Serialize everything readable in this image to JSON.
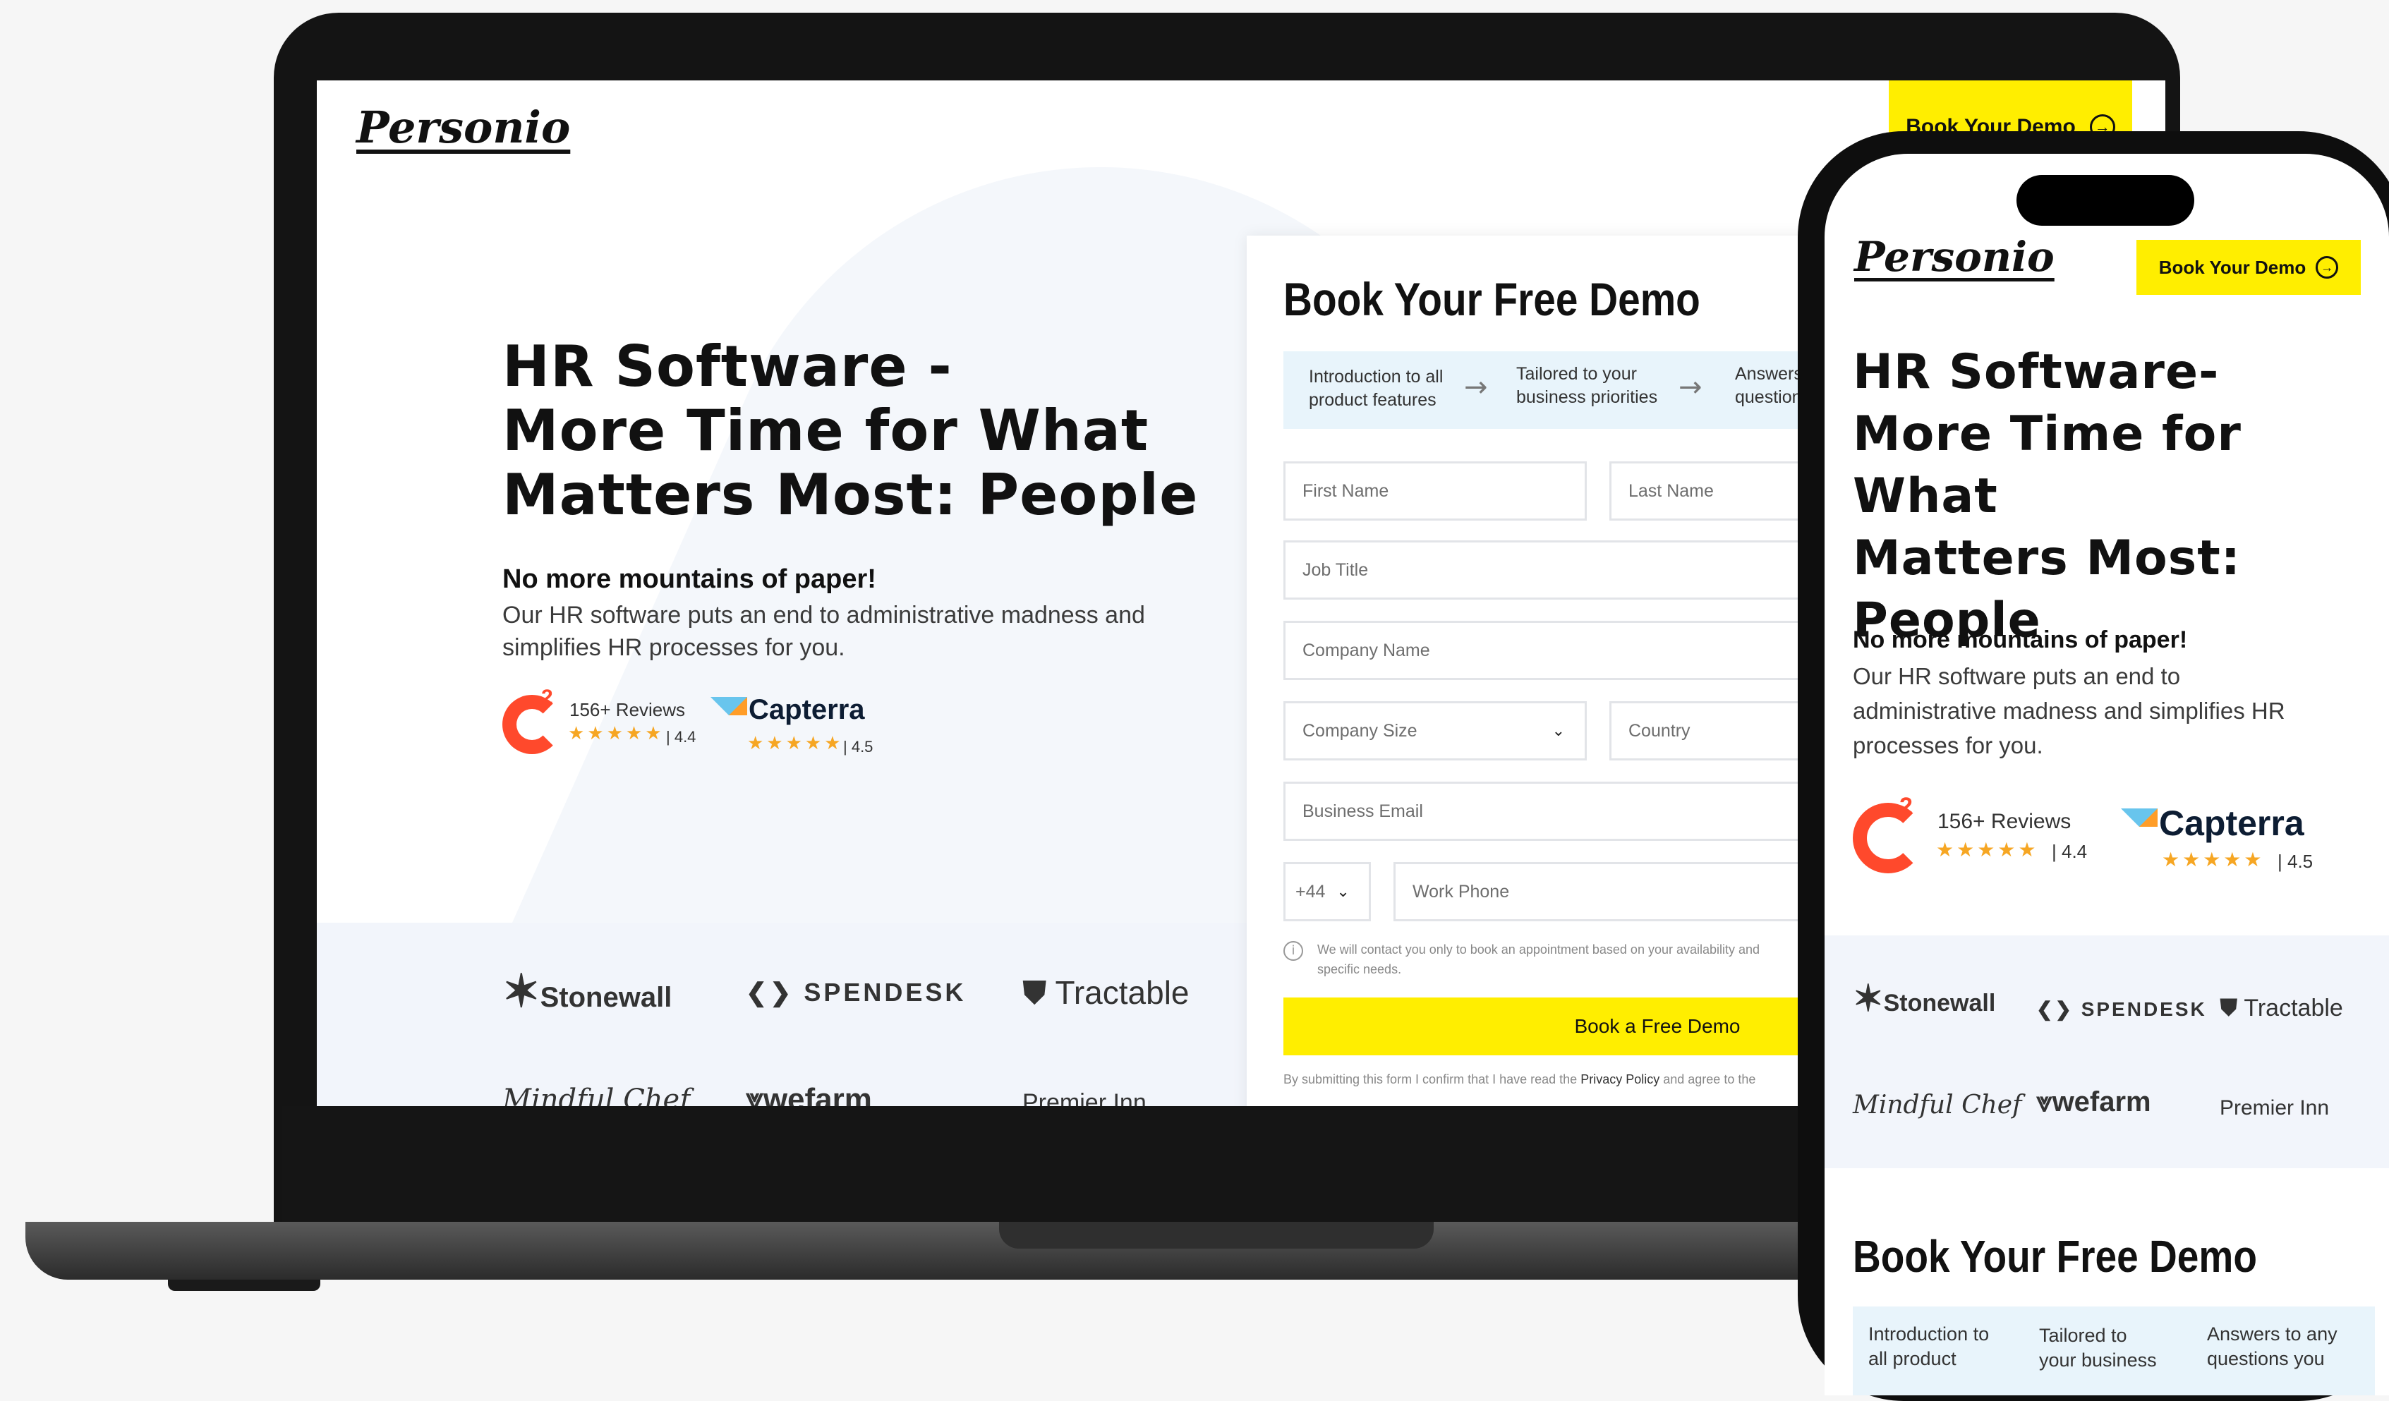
{
  "laptop": {
    "logo": "Personio",
    "nav_cta": "Book Your Demo",
    "hero": {
      "title_line1": "HR Software -",
      "title_line2": "More Time for What",
      "title_line3": "Matters Most: People",
      "subtitle": "No more mountains of paper!",
      "description_line1": "Our HR software puts an end to administrative madness and",
      "description_line2": "simplifies HR processes for you."
    },
    "reviews": {
      "g2_count": "156+ Reviews",
      "g2_rating": "| 4.4",
      "capterra_name": "Capterra",
      "capterra_rating": "| 4.5"
    },
    "brands": [
      "Stonewall",
      "SPENDESK",
      "Tractable",
      "Mindful Chef",
      "wefarm",
      "Premier Inn"
    ],
    "form": {
      "title": "Book Your Free Demo",
      "steps": [
        "Introduction to all product features",
        "Tailored to your business priorities",
        "Answers to any questions"
      ],
      "fields": {
        "first_name": "First Name",
        "last_name": "Last Name",
        "job_title": "Job Title",
        "company_name": "Company Name",
        "company_size": "Company Size",
        "country": "Country",
        "business_email": "Business Email",
        "phone_code": "+44",
        "work_phone": "Work Phone"
      },
      "note_line1": "We will contact you only to book an appointment based on your availability and",
      "note_line2": "specific needs.",
      "submit": "Book a Free Demo",
      "disclaimer_prefix": "By submitting this form I confirm that I have read the",
      "disclaimer_link": "Privacy Policy",
      "disclaimer_suffix": "and agree to the"
    }
  },
  "phone": {
    "logo": "Personio",
    "nav_cta": "Book Your Demo",
    "hero": {
      "title_line1": "HR Software-",
      "title_line2": "More Time for What",
      "title_line3": "Matters Most:",
      "title_line4": "People",
      "subtitle": "No more mountains of paper!",
      "description_line1": "Our HR software puts an end to",
      "description_line2": "administrative madness and simplifies HR",
      "description_line3": "processes for you."
    },
    "reviews": {
      "g2_count": "156+ Reviews",
      "g2_rating": "| 4.4",
      "capterra_name": "Capterra",
      "capterra_rating": "| 4.5"
    },
    "brands": [
      "Stonewall",
      "SPENDESK",
      "Tractable",
      "Mindful Chef",
      "wefarm",
      "Premier Inn"
    ],
    "form_title": "Book Your Free Demo",
    "steps": [
      "Introduction to all product",
      "Tailored to your business",
      "Answers to any questions you"
    ]
  },
  "colors": {
    "accent_yellow": "#ffee00",
    "g2_red": "#ff492c",
    "star_orange": "#f6a623",
    "band_blue": "#f2f5fb",
    "steps_blue": "#e8f4fb"
  }
}
